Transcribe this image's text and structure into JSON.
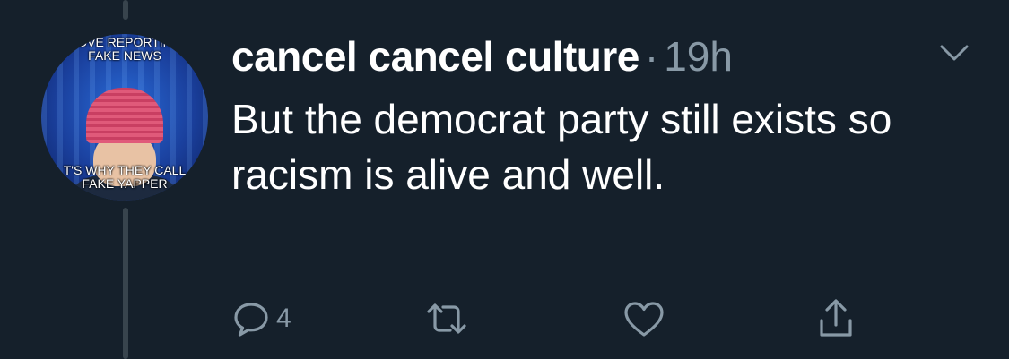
{
  "author": {
    "display_name": "cancel cancel culture",
    "separator": "·",
    "timestamp": "19h"
  },
  "avatar": {
    "caption_top_line1": "OVE REPORTIN",
    "caption_top_line2": "FAKE NEWS",
    "caption_bottom_line1": "T'S WHY THEY CALL",
    "caption_bottom_line2": "FAKE YAPPER"
  },
  "tweet": {
    "text": "But the democrat party still exists so racism is alive and well."
  },
  "actions": {
    "reply_count": "4"
  },
  "icons": {
    "reply": "reply-icon",
    "retweet": "retweet-icon",
    "like": "heart-icon",
    "share": "share-icon",
    "menu": "chevron-down-icon"
  },
  "colors": {
    "background": "#15202b",
    "text": "#ffffff",
    "secondary": "#8899a6",
    "thread_line": "#38444d"
  }
}
